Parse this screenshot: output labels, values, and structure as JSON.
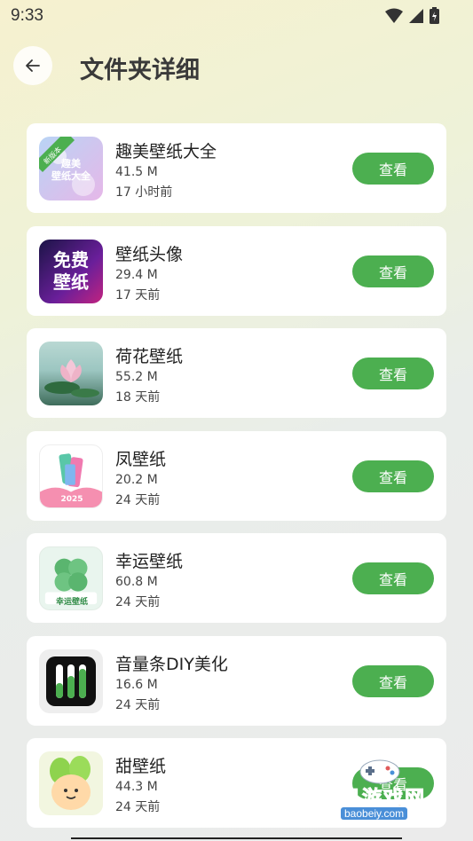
{
  "status_bar": {
    "time": "9:33"
  },
  "header": {
    "title": "文件夹详细"
  },
  "items": [
    {
      "name": "趣美壁纸大全",
      "size": "41.5 M",
      "time": "17 小时前",
      "button": "查看",
      "thumb_text": "趣美\n壁纸大全",
      "badge": "新版本",
      "colors": [
        "#b9d4f5",
        "#e6b7e8"
      ]
    },
    {
      "name": "壁纸头像",
      "size": "29.4 M",
      "time": "17 天前",
      "button": "查看",
      "thumb_text": "免费\n壁纸",
      "colors": [
        "#1b1446",
        "#c2237f"
      ]
    },
    {
      "name": "荷花壁纸",
      "size": "55.2 M",
      "time": "18 天前",
      "button": "查看",
      "colors": [
        "#9cc6c1",
        "#3f6d5b"
      ]
    },
    {
      "name": "凤壁纸",
      "size": "20.2 M",
      "time": "24 天前",
      "button": "查看",
      "thumb_text": "2025",
      "colors": [
        "#ffffff",
        "#f58fb0"
      ]
    },
    {
      "name": "幸运壁纸",
      "size": "60.8 M",
      "time": "24 天前",
      "button": "查看",
      "thumb_text": "幸运壁纸",
      "colors": [
        "#e9f5ee",
        "#3e9e57"
      ]
    },
    {
      "name": "音量条DIY美化",
      "size": "16.6 M",
      "time": "24 天前",
      "button": "查看",
      "colors": [
        "#f0f0f0",
        "#111111"
      ]
    },
    {
      "name": "甜壁纸",
      "size": "44.3 M",
      "time": "24 天前",
      "button": "查看",
      "colors": [
        "#f2f6e0",
        "#8ed34e"
      ]
    }
  ],
  "watermark": {
    "text": "宝贝游戏网",
    "url": "baobeiy.com"
  },
  "accent": "#4caf50"
}
